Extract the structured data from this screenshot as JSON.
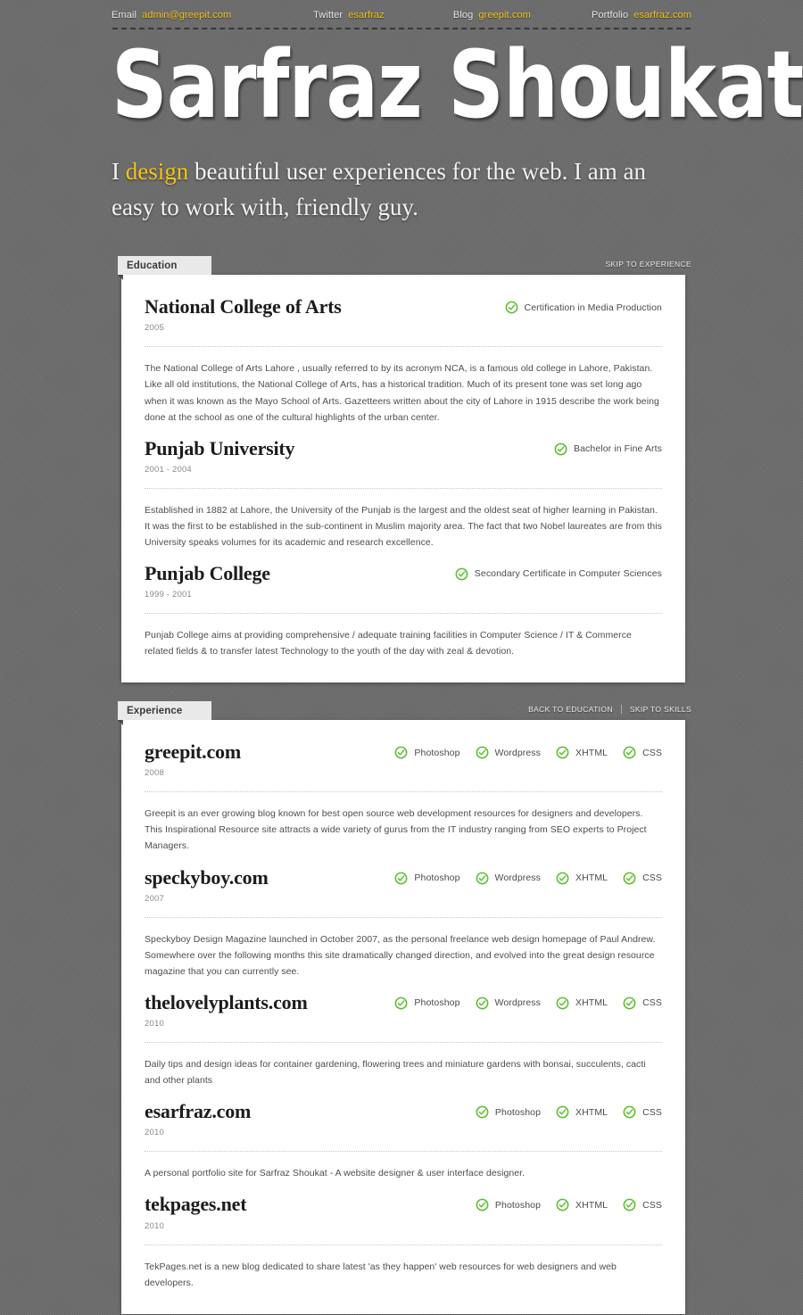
{
  "topbar": {
    "items": [
      {
        "label": "Email",
        "value": "admin@greepit.com"
      },
      {
        "label": "Twitter",
        "value": "esarfraz"
      },
      {
        "label": "Blog",
        "value": "greepit.com"
      },
      {
        "label": "Portfolio",
        "value": "esarfraz.com"
      }
    ]
  },
  "hero": {
    "name": "Sarfraz Shoukat",
    "tagline_part1": "I ",
    "tagline_accent": "design",
    "tagline_part2": " beautiful user experiences for the web. I am an easy to work with, friendly guy."
  },
  "colors": {
    "background": "#6c6c6c",
    "accent_yellow": "#f5c518",
    "check_green": "#5bbf2d",
    "tab_gray": "#e9e9e9",
    "card_white": "#ffffff"
  },
  "sections": [
    {
      "tab_label": "Education",
      "nav": [
        {
          "label": "SKIP TO EXPERIENCE"
        }
      ],
      "entries": [
        {
          "title": "National College of Arts",
          "date": "2005",
          "tags": [
            "Certification in Media Production"
          ],
          "body": "The National College of Arts Lahore , usually referred to by its acronym NCA, is a famous old college in Lahore, Pakistan. Like all old institutions, the National College of Arts, has a historical tradition. Much of its present tone was set long ago when it was known as the Mayo School of Arts. Gazetteers written about the city of Lahore in 1915 describe the work being done at the school as one of the cultural highlights of the urban center."
        },
        {
          "title": "Punjab University",
          "date": "2001 - 2004",
          "tags": [
            "Bachelor in Fine Arts"
          ],
          "body": "Established in 1882 at Lahore, the University of the Punjab is the largest and the oldest seat of higher learning in Pakistan. It was the first to be established in the sub-continent in Muslim majority area. The fact that two Nobel laureates are from this University speaks volumes for its academic and research excellence."
        },
        {
          "title": "Punjab College",
          "date": "1999 - 2001",
          "tags": [
            "Secondary Certificate in Computer Sciences"
          ],
          "body": "Punjab College aims at providing comprehensive / adequate training facilities in Computer Science / IT & Commerce related fields & to transfer latest Technology to the youth of the day with zeal & devotion."
        }
      ]
    },
    {
      "tab_label": "Experience",
      "nav": [
        {
          "label": "BACK TO EDUCATION"
        },
        {
          "label": "SKIP TO SKILLS"
        }
      ],
      "entries": [
        {
          "title": "greepit.com",
          "date": "2008",
          "tags": [
            "Photoshop",
            "Wordpress",
            "XHTML",
            "CSS"
          ],
          "body": "Greepit is an ever growing blog known for best open source web development resources for designers and developers. This Inspirational Resource site attracts a wide variety of gurus from the IT industry ranging from SEO experts to Project Managers."
        },
        {
          "title": "speckyboy.com",
          "date": "2007",
          "tags": [
            "Photoshop",
            "Wordpress",
            "XHTML",
            "CSS"
          ],
          "body": "Speckyboy Design Magazine launched in October 2007, as the personal freelance web design homepage of Paul Andrew. Somewhere over the following months this site dramatically changed direction, and evolved into the great design resource magazine that you can currently see."
        },
        {
          "title": "thelovelyplants.com",
          "date": "2010",
          "tags": [
            "Photoshop",
            "Wordpress",
            "XHTML",
            "CSS"
          ],
          "body": "Daily tips and design ideas for container gardening, flowering trees and miniature gardens with bonsai, succulents, cacti and other plants"
        },
        {
          "title": "esarfraz.com",
          "date": "2010",
          "tags": [
            "Photoshop",
            "XHTML",
            "CSS"
          ],
          "body": "A personal portfolio site for Sarfraz Shoukat - A website designer & user interface designer."
        },
        {
          "title": "tekpages.net",
          "date": "2010",
          "tags": [
            "Photoshop",
            "XHTML",
            "CSS"
          ],
          "body": "TekPages.net is a new blog dedicated to share latest 'as they happen' web resources for web designers and web developers."
        }
      ]
    }
  ]
}
